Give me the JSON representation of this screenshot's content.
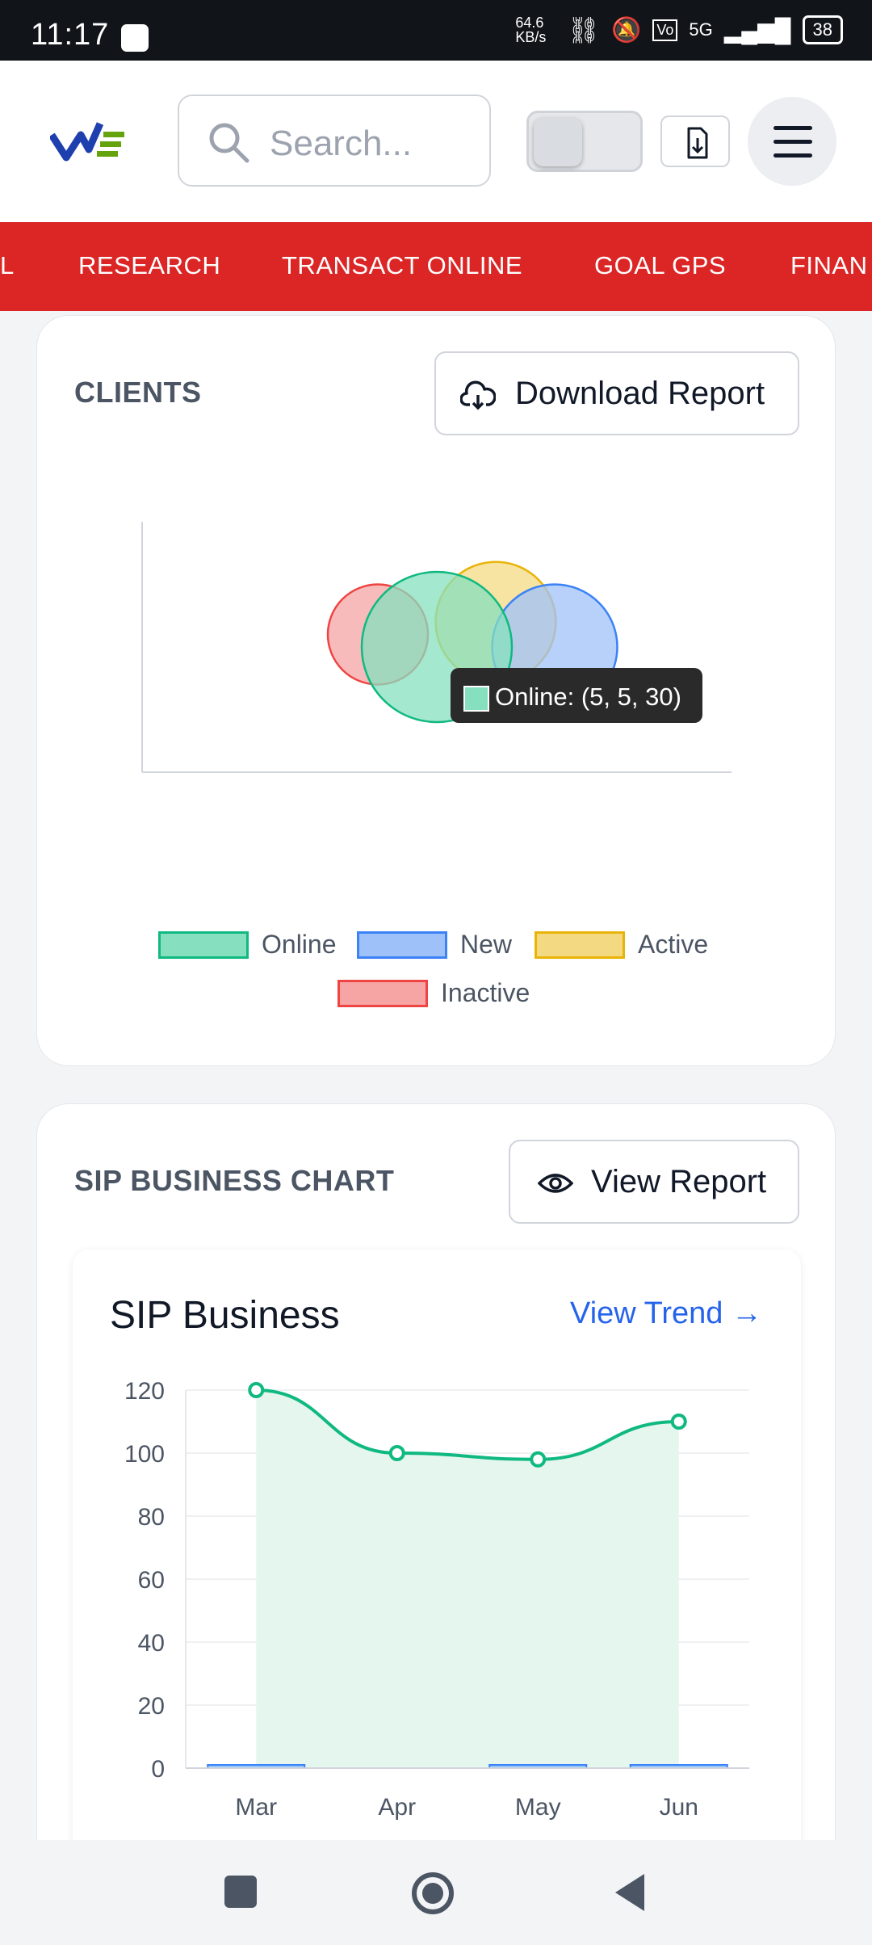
{
  "status_bar": {
    "time": "11:17",
    "network_speed": "64.6 KB/s",
    "network_type": "5G",
    "battery": "38"
  },
  "header": {
    "search_placeholder": "Search..."
  },
  "nav": {
    "items": [
      "L",
      "RESEARCH",
      "TRANSACT ONLINE",
      "GOAL GPS",
      "FINAN"
    ]
  },
  "clients_card": {
    "title": "CLIENTS",
    "button_label": "Download Report",
    "tooltip": "Online: (5, 5, 30)",
    "legend": [
      {
        "label": "Online",
        "fill": "#86e0bf",
        "stroke": "#10b981"
      },
      {
        "label": "New",
        "fill": "#9fc1f9",
        "stroke": "#3b82f6"
      },
      {
        "label": "Active",
        "fill": "#f4d983",
        "stroke": "#eab308"
      },
      {
        "label": "Inactive",
        "fill": "#f6a4a4",
        "stroke": "#ef4444"
      }
    ]
  },
  "sip_card": {
    "title": "SIP BUSINESS CHART",
    "button_label": "View Report",
    "chart_title": "SIP Business",
    "trend_link": "View Trend →"
  },
  "chart_data": [
    {
      "type": "scatter",
      "subtype": "bubble",
      "series": [
        {
          "name": "Online",
          "points": [
            {
              "x": 5,
              "y": 5,
              "r": 30
            }
          ],
          "color": "#10b981"
        },
        {
          "name": "New",
          "points": [
            {
              "x": 7,
              "y": 5,
              "r": 25
            }
          ],
          "color": "#3b82f6"
        },
        {
          "name": "Active",
          "points": [
            {
              "x": 6,
              "y": 6,
              "r": 24
            }
          ],
          "color": "#eab308"
        },
        {
          "name": "Inactive",
          "points": [
            {
              "x": 4,
              "y": 5.5,
              "r": 20
            }
          ],
          "color": "#ef4444"
        }
      ],
      "xlim": [
        0,
        10
      ],
      "ylim": [
        0,
        10
      ],
      "legend_position": "bottom"
    },
    {
      "type": "line",
      "title": "SIP Business",
      "categories": [
        "Mar",
        "Apr",
        "May",
        "Jun"
      ],
      "series": [
        {
          "values": [
            120,
            100,
            98,
            110
          ],
          "color": "#10b981",
          "fill": "area"
        },
        {
          "values": [
            1,
            0,
            1,
            1
          ],
          "color": "#3b82f6",
          "kind": "bar"
        }
      ],
      "yticks": [
        0,
        20,
        40,
        60,
        80,
        100,
        120
      ],
      "ylim": [
        0,
        120
      ],
      "grid": true
    }
  ]
}
